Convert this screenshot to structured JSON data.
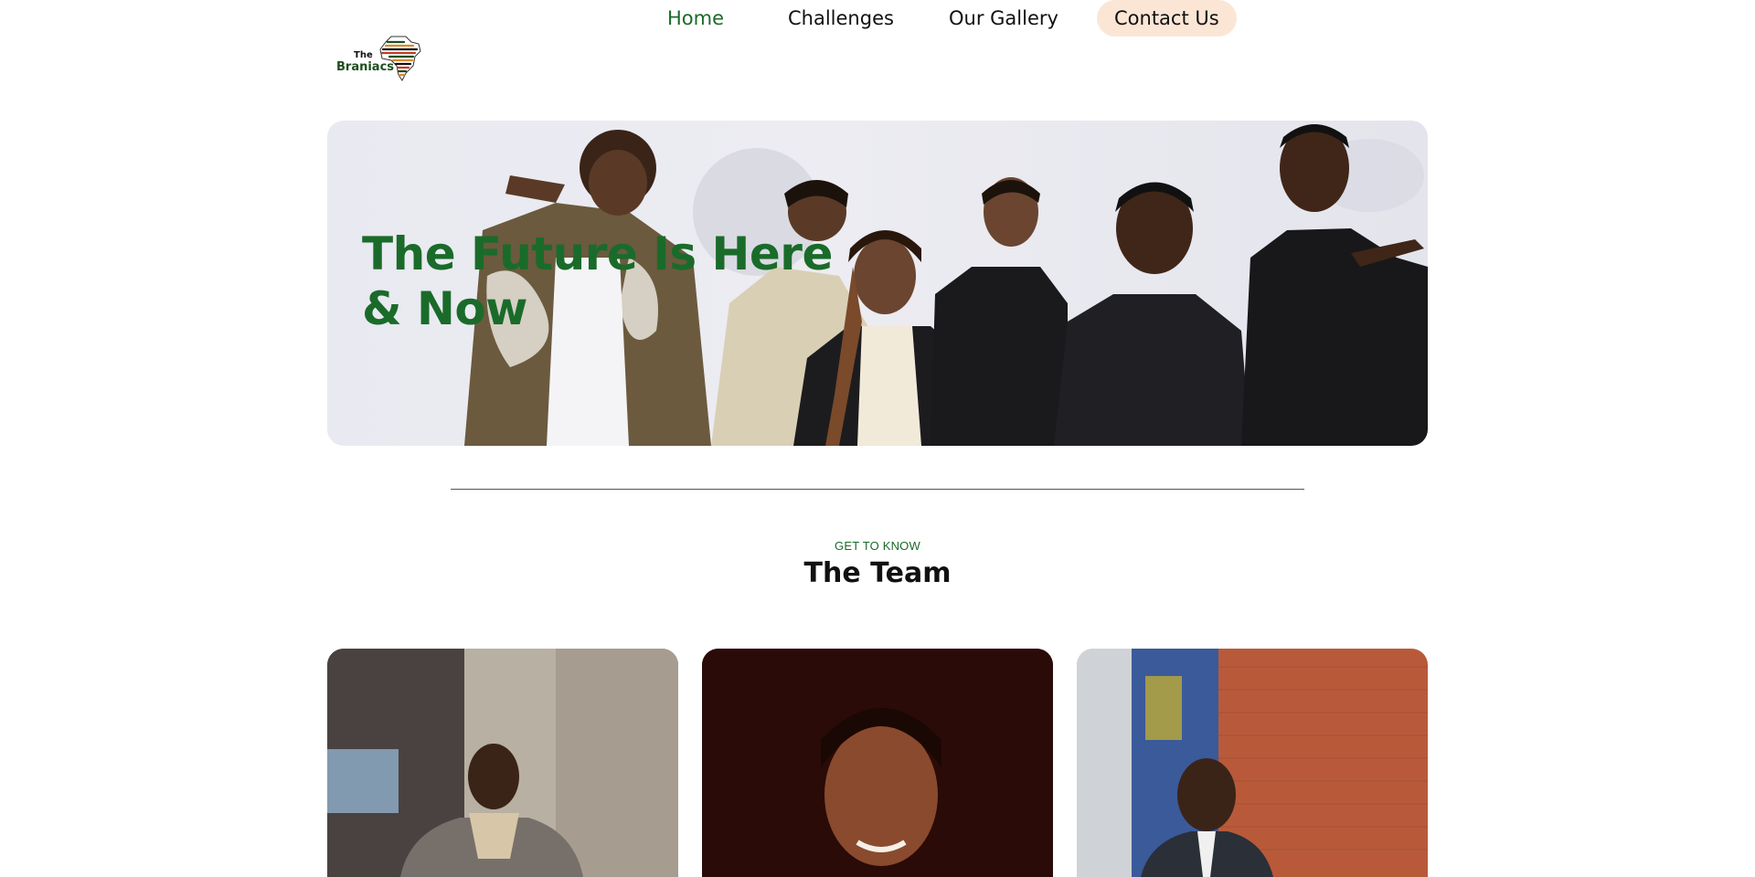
{
  "header": {
    "logo": {
      "line1": "The",
      "line2": "Braniacs"
    },
    "nav": [
      {
        "label": "Home",
        "active": true
      },
      {
        "label": "Challenges"
      },
      {
        "label": "Our Gallery"
      },
      {
        "label": "Contact Us",
        "highlighted": true
      }
    ]
  },
  "hero": {
    "title": "The Future Is Here & Now"
  },
  "team_section": {
    "eyebrow": "GET TO KNOW",
    "title": "The Team"
  },
  "colors": {
    "accent_green": "#1a6b2a",
    "contact_pill": "#fbe6d6",
    "text": "#111111",
    "background": "#ffffff"
  }
}
